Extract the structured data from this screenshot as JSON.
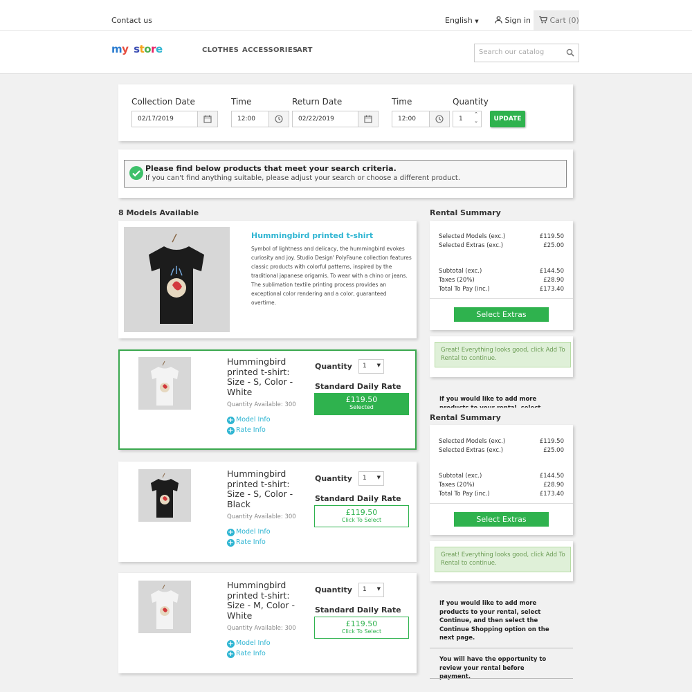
{
  "topbar": {
    "contact": "Contact us",
    "language": "English",
    "signin": "Sign in",
    "cart": "Cart (0)"
  },
  "header": {
    "logo": [
      "m",
      "y",
      " ",
      "s",
      "t",
      "o",
      "r",
      "e"
    ],
    "logo_colors": [
      "#2a7cd0",
      "#e64b3c",
      " ",
      "#3f51b5",
      "#f4a21c",
      "#4caf50",
      "#e91e63",
      "#2fb5d2"
    ],
    "nav": [
      "CLOTHES",
      "ACCESSORIES",
      "ART"
    ],
    "search_placeholder": "Search our catalog"
  },
  "booking": {
    "collection_date_label": "Collection Date",
    "collection_date": "02/17/2019",
    "time_label": "Time",
    "time1": "12:00",
    "return_date_label": "Return Date",
    "return_date": "02/22/2019",
    "time2_label": "Time",
    "time2": "12:00",
    "quantity_label": "Quantity",
    "quantity": "1",
    "update_label": "UPDATE"
  },
  "notice": {
    "title": "Please find below products that meet your search criteria.",
    "text": "If you can't find anything suitable, please adjust your search or choose a different product."
  },
  "models_header": "8 Models Available",
  "product": {
    "title": "Hummingbird printed t-shirt",
    "description": "Symbol of lightness and delicacy, the hummingbird evokes curiosity and joy. Studio Design' PolyFaune collection features classic products with colorful patterns, inspired by the traditional japanese origamis. To wear with a chino or jeans. The sublimation textile printing process provides an exceptional color rendering and a color, guaranteed overtime."
  },
  "variants": [
    {
      "title": "Hummingbird printed t-shirt: Size - S, Color - White",
      "qty": "Quantity Available: 300",
      "model_info": "Model Info",
      "rate_info": "Rate Info",
      "quantity_label": "Quantity",
      "quantity": "1",
      "rate_label": "Standard Daily Rate",
      "price": "£119.50",
      "status": "Selected",
      "selected": true,
      "shirt": "white"
    },
    {
      "title": "Hummingbird printed t-shirt: Size - S, Color - Black",
      "qty": "Quantity Available: 300",
      "model_info": "Model Info",
      "rate_info": "Rate Info",
      "quantity_label": "Quantity",
      "quantity": "1",
      "rate_label": "Standard Daily Rate",
      "price": "£119.50",
      "status": "Click To Select",
      "selected": false,
      "shirt": "black"
    },
    {
      "title": "Hummingbird printed t-shirt: Size - M, Color - White",
      "qty": "Quantity Available: 300",
      "model_info": "Model Info",
      "rate_info": "Rate Info",
      "quantity_label": "Quantity",
      "quantity": "1",
      "rate_label": "Standard Daily Rate",
      "price": "£119.50",
      "status": "Click To Select",
      "selected": false,
      "shirt": "white"
    }
  ],
  "summaries": [
    {
      "heading": "Rental Summary",
      "rows": [
        {
          "label": "Selected Models (exc.)",
          "value": "£119.50"
        },
        {
          "label": "Selected Extras (exc.)",
          "value": "£25.00"
        },
        {
          "label": "Subtotal (exc.)",
          "value": "£144.50"
        },
        {
          "label": "Taxes (20%)",
          "value": "£28.90"
        },
        {
          "label": "Total To Pay (inc.)",
          "value": "£173.40"
        }
      ],
      "button": "Select Extras",
      "ok_message": "Great! Everything looks good, click Add To Rental to continue.",
      "info": "If you would like to add more products to your rental, select"
    },
    {
      "heading": "Rental Summary",
      "rows": [
        {
          "label": "Selected Models (exc.)",
          "value": "£119.50"
        },
        {
          "label": "Selected Extras (exc.)",
          "value": "£25.00"
        },
        {
          "label": "Subtotal (exc.)",
          "value": "£144.50"
        },
        {
          "label": "Taxes (20%)",
          "value": "£28.90"
        },
        {
          "label": "Total To Pay (inc.)",
          "value": "£173.40"
        }
      ],
      "button": "Select Extras",
      "ok_message": "Great! Everything looks good, click Add To Rental to continue.",
      "info": "If you would like to add more products to your rental, select Continue, and then select the Continue Shopping option on the next page.",
      "info2": "You will have the opportunity to review your rental before payment."
    }
  ]
}
